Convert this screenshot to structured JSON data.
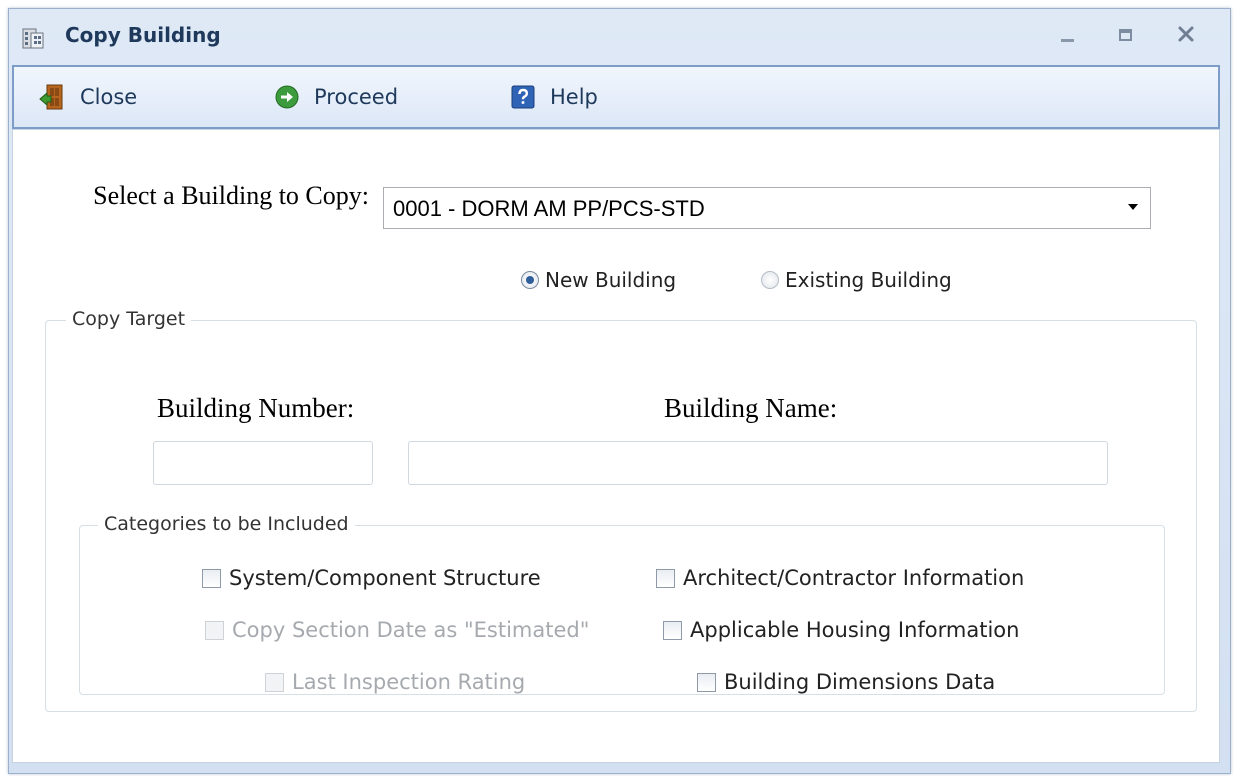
{
  "window": {
    "title": "Copy Building",
    "icons": {
      "app": "building-icon",
      "minimize": "minimize-icon",
      "maximize": "maximize-icon",
      "close": "close-icon"
    }
  },
  "toolbar": {
    "close_label": "Close",
    "proceed_label": "Proceed",
    "help_label": "Help"
  },
  "source": {
    "label": "Select a Building to Copy:",
    "selected_building": "0001 - DORM AM PP/PCS-STD"
  },
  "target_type": {
    "options": [
      {
        "label": "New Building",
        "checked": true
      },
      {
        "label": "Existing Building",
        "checked": false
      }
    ]
  },
  "copy_target": {
    "legend": "Copy Target",
    "building_number_label": "Building Number:",
    "building_number_value": "",
    "building_name_label": "Building Name:",
    "building_name_value": ""
  },
  "categories": {
    "legend": "Categories to be Included",
    "items": [
      {
        "label": "System/Component Structure",
        "checked": false,
        "enabled": true
      },
      {
        "label": "Architect/Contractor Information",
        "checked": false,
        "enabled": true
      },
      {
        "label": "Copy Section Date as \"Estimated\"",
        "checked": false,
        "enabled": false
      },
      {
        "label": "Applicable Housing Information",
        "checked": false,
        "enabled": true
      },
      {
        "label": "Last Inspection Rating",
        "checked": false,
        "enabled": false
      },
      {
        "label": "Building Dimensions Data",
        "checked": false,
        "enabled": true
      }
    ]
  },
  "colors": {
    "title_text": "#1e395b",
    "window_frame": "#dfe9f6",
    "toolbar_border": "#7e9cc8",
    "disabled_text": "#a6aaaf"
  }
}
